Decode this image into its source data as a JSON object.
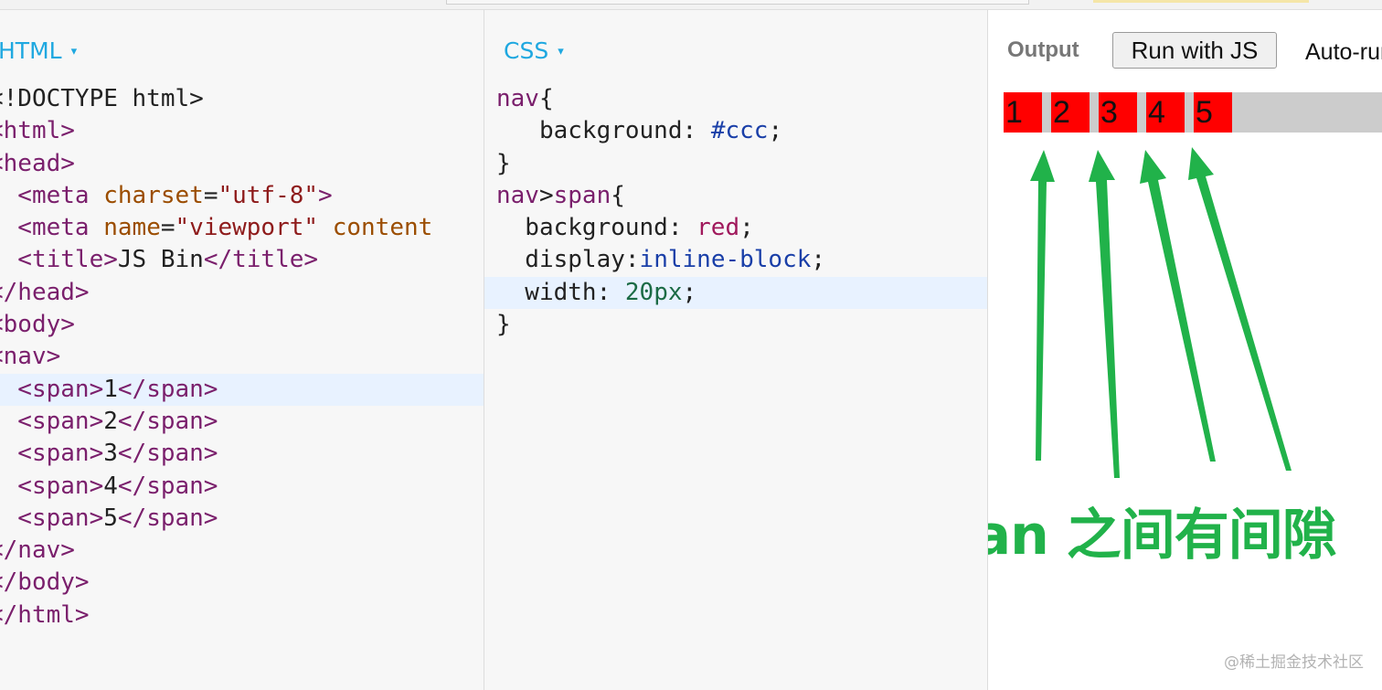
{
  "html_panel": {
    "title": "HTML",
    "caret": "▾",
    "lines": [
      [
        {
          "t": "<!DOCTYPE html>",
          "c": "txt"
        }
      ],
      [
        {
          "t": "<html>",
          "c": "tag"
        }
      ],
      [
        {
          "t": "<head>",
          "c": "tag"
        }
      ],
      [
        {
          "t": "  <meta ",
          "c": "tag"
        },
        {
          "t": "charset",
          "c": "attr"
        },
        {
          "t": "=",
          "c": "txt"
        },
        {
          "t": "\"utf-8\"",
          "c": "str"
        },
        {
          "t": ">",
          "c": "tag"
        }
      ],
      [
        {
          "t": "  <meta ",
          "c": "tag"
        },
        {
          "t": "name",
          "c": "attr"
        },
        {
          "t": "=",
          "c": "txt"
        },
        {
          "t": "\"viewport\"",
          "c": "str"
        },
        {
          "t": " content",
          "c": "attr"
        }
      ],
      [
        {
          "t": "  <title>",
          "c": "tag"
        },
        {
          "t": "JS Bin",
          "c": "txt"
        },
        {
          "t": "</title>",
          "c": "tag"
        }
      ],
      [
        {
          "t": "</head>",
          "c": "tag"
        }
      ],
      [
        {
          "t": "<body>",
          "c": "tag"
        }
      ],
      [
        {
          "t": "<nav>",
          "c": "tag"
        }
      ],
      [
        {
          "t": "  <span>",
          "c": "tag"
        },
        {
          "t": "1",
          "c": "txt"
        },
        {
          "t": "</span>",
          "c": "tag"
        }
      ],
      [
        {
          "t": "  <span>",
          "c": "tag"
        },
        {
          "t": "2",
          "c": "txt"
        },
        {
          "t": "</span>",
          "c": "tag"
        }
      ],
      [
        {
          "t": "  <span>",
          "c": "tag"
        },
        {
          "t": "3",
          "c": "txt"
        },
        {
          "t": "</span>",
          "c": "tag"
        }
      ],
      [
        {
          "t": "  <span>",
          "c": "tag"
        },
        {
          "t": "4",
          "c": "txt"
        },
        {
          "t": "</span>",
          "c": "tag"
        }
      ],
      [
        {
          "t": "  <span>",
          "c": "tag"
        },
        {
          "t": "5",
          "c": "txt"
        },
        {
          "t": "</span>",
          "c": "tag"
        }
      ],
      [
        {
          "t": "</nav>",
          "c": "tag"
        }
      ],
      [
        {
          "t": "</body>",
          "c": "tag"
        }
      ],
      [
        {
          "t": "</html>",
          "c": "tag"
        }
      ]
    ],
    "highlighted_line": 9
  },
  "css_panel": {
    "title": "CSS",
    "caret": "▾",
    "lines": [
      [
        {
          "t": "nav",
          "c": "sel"
        },
        {
          "t": "{",
          "c": "txt"
        }
      ],
      [
        {
          "t": "   background",
          "c": "prop"
        },
        {
          "t": ": ",
          "c": "txt"
        },
        {
          "t": "#ccc",
          "c": "val"
        },
        {
          "t": ";",
          "c": "txt"
        }
      ],
      [
        {
          "t": "}",
          "c": "txt"
        }
      ],
      [
        {
          "t": "nav",
          "c": "sel"
        },
        {
          "t": ">",
          "c": "txt"
        },
        {
          "t": "span",
          "c": "sel"
        },
        {
          "t": "{",
          "c": "txt"
        }
      ],
      [
        {
          "t": "  background",
          "c": "prop"
        },
        {
          "t": ": ",
          "c": "txt"
        },
        {
          "t": "red",
          "c": "kw"
        },
        {
          "t": ";",
          "c": "txt"
        }
      ],
      [
        {
          "t": "  display",
          "c": "prop"
        },
        {
          "t": ":",
          "c": "txt"
        },
        {
          "t": "inline-block",
          "c": "val"
        },
        {
          "t": ";",
          "c": "txt"
        }
      ],
      [
        {
          "t": "  width",
          "c": "prop"
        },
        {
          "t": ": ",
          "c": "txt"
        },
        {
          "t": "20px",
          "c": "num"
        },
        {
          "t": ";",
          "c": "txt"
        }
      ],
      [
        {
          "t": "}",
          "c": "txt"
        }
      ]
    ],
    "highlighted_line": 6
  },
  "output_panel": {
    "label": "Output",
    "run_button": "Run with JS",
    "auto_run": "Auto-run JS",
    "nav_spans": [
      "1",
      "2",
      "3",
      "4",
      "5"
    ],
    "colors": {
      "nav_bg": "#cccccc",
      "span_bg": "#ff0000"
    }
  },
  "annotation": {
    "text": "span 之间有间隙",
    "color": "#21b24a"
  },
  "watermark": "@稀土掘金技术社区"
}
